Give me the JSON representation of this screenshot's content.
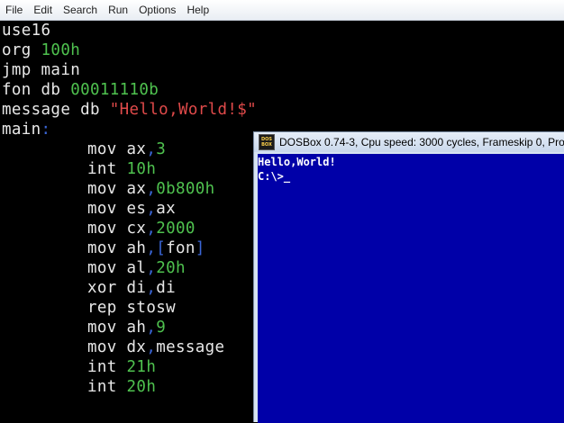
{
  "menu": {
    "items": [
      "File",
      "Edit",
      "Search",
      "Run",
      "Options",
      "Help"
    ]
  },
  "editor": {
    "lines": [
      {
        "segments": [
          {
            "text": "use16",
            "color": "w"
          }
        ]
      },
      {
        "segments": [
          {
            "text": "org ",
            "color": "w"
          },
          {
            "text": "100h",
            "color": "g"
          }
        ]
      },
      {
        "segments": [
          {
            "text": "jmp main",
            "color": "w"
          }
        ]
      },
      {
        "segments": [
          {
            "text": "fon db ",
            "color": "w"
          },
          {
            "text": "00011110b",
            "color": "g"
          }
        ]
      },
      {
        "segments": [
          {
            "text": "message db ",
            "color": "w"
          },
          {
            "text": "\"Hello,World!$\"",
            "color": "r"
          }
        ]
      },
      {
        "segments": [
          {
            "text": "main",
            "color": "w"
          },
          {
            "text": ":",
            "color": "b"
          }
        ]
      },
      {
        "segments": [
          {
            "text": "mov ax",
            "color": "w"
          },
          {
            "text": ",",
            "color": "b"
          },
          {
            "text": "3",
            "color": "g"
          }
        ],
        "indent": true
      },
      {
        "segments": [
          {
            "text": "int ",
            "color": "w"
          },
          {
            "text": "10h",
            "color": "g"
          }
        ],
        "indent": true
      },
      {
        "segments": [
          {
            "text": "mov ax",
            "color": "w"
          },
          {
            "text": ",",
            "color": "b"
          },
          {
            "text": "0b800h",
            "color": "g"
          }
        ],
        "indent": true
      },
      {
        "segments": [
          {
            "text": "mov es",
            "color": "w"
          },
          {
            "text": ",",
            "color": "b"
          },
          {
            "text": "ax",
            "color": "w"
          }
        ],
        "indent": true
      },
      {
        "segments": [
          {
            "text": "mov cx",
            "color": "w"
          },
          {
            "text": ",",
            "color": "b"
          },
          {
            "text": "2000",
            "color": "g"
          }
        ],
        "indent": true
      },
      {
        "segments": [
          {
            "text": "mov ah",
            "color": "w"
          },
          {
            "text": ",[",
            "color": "b"
          },
          {
            "text": "fon",
            "color": "w"
          },
          {
            "text": "]",
            "color": "b"
          }
        ],
        "indent": true
      },
      {
        "segments": [
          {
            "text": "mov al",
            "color": "w"
          },
          {
            "text": ",",
            "color": "b"
          },
          {
            "text": "20h",
            "color": "g"
          }
        ],
        "indent": true
      },
      {
        "segments": [
          {
            "text": "xor di",
            "color": "w"
          },
          {
            "text": ",",
            "color": "b"
          },
          {
            "text": "di",
            "color": "w"
          }
        ],
        "indent": true
      },
      {
        "segments": [
          {
            "text": "rep stosw",
            "color": "w"
          }
        ],
        "indent": true
      },
      {
        "segments": [
          {
            "text": "mov ah",
            "color": "w"
          },
          {
            "text": ",",
            "color": "b"
          },
          {
            "text": "9",
            "color": "g"
          }
        ],
        "indent": true
      },
      {
        "segments": [
          {
            "text": "mov dx",
            "color": "w"
          },
          {
            "text": ",",
            "color": "b"
          },
          {
            "text": "message",
            "color": "w"
          }
        ],
        "indent": true
      },
      {
        "segments": [
          {
            "text": "int ",
            "color": "w"
          },
          {
            "text": "21h",
            "color": "g"
          }
        ],
        "indent": true
      },
      {
        "segments": [
          {
            "text": "int ",
            "color": "w"
          },
          {
            "text": "20h",
            "color": "g"
          }
        ],
        "indent": true
      }
    ]
  },
  "dosbox": {
    "title": "DOSBox 0.74-3, Cpu speed:     3000 cycles, Frameskip  0, Pro",
    "icon_text": [
      "DOS",
      "BOX"
    ],
    "icon": "dosbox-icon",
    "screen_lines": [
      "Hello,World!",
      "C:\\>"
    ],
    "cursor": "_"
  },
  "colors": {
    "editor_bg": "#000000",
    "text": "#e8e8e8",
    "number": "#4fc24f",
    "string": "#e04a4a",
    "punct": "#3a66d8",
    "dos_screen_bg": "#0000a8",
    "dos_text": "#ffffff"
  }
}
